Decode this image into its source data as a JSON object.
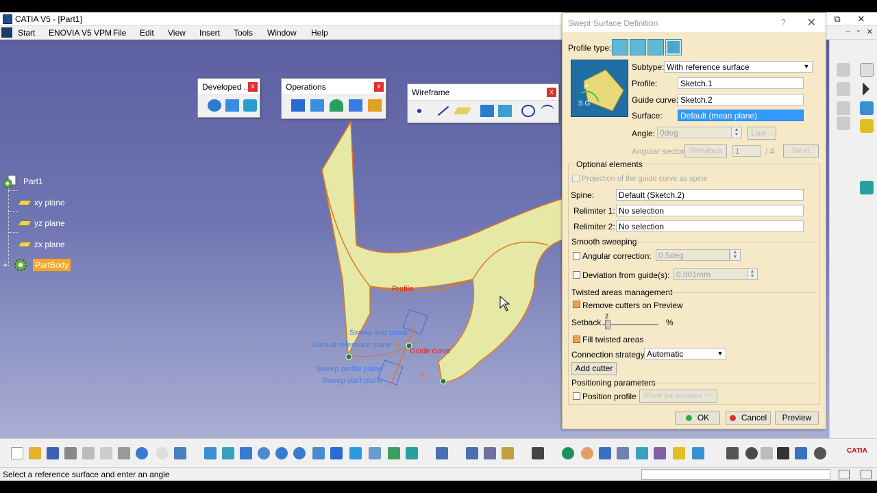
{
  "window": {
    "title": "CATIA V5 - [Part1]",
    "controls": [
      "⧉",
      "✕"
    ],
    "doc_controls": [
      "–",
      "▫",
      "✕"
    ]
  },
  "menu": {
    "items": [
      "Start",
      "ENOVIA V5 VPM",
      "File",
      "Edit",
      "View",
      "Insert",
      "Tools",
      "Window",
      "Help"
    ]
  },
  "tree": {
    "root": "Part1",
    "items": [
      "xy plane",
      "yz plane",
      "zx plane"
    ],
    "body": "PartBody"
  },
  "toolbars": {
    "developed": "Developed ...",
    "operations": "Operations",
    "wireframe": "Wireframe",
    "close": "x"
  },
  "viewport_labels": {
    "profile": "Profile",
    "sweep_end_plane": "Sweep end plane",
    "default_reference_plane": "Default reference plane",
    "guide_curve": "Guide curve",
    "sweep_profile_plane": "Sweep profile plane",
    "sweep_start_plane": "Sweep start plane",
    "h1": "H",
    "h2": "H"
  },
  "dialog": {
    "title": "Swept Surface Definition",
    "help": "?",
    "close": "✕",
    "profile_type_label": "Profile type:",
    "subtype_label": "Subtype:",
    "subtype_value": "With reference surface",
    "profile_label": "Profile:",
    "profile_value": "Sketch.1",
    "guide_label": "Guide curve:",
    "guide_value": "Sketch.2",
    "surface_label": "Surface:",
    "surface_value": "Default (mean plane)",
    "angle_label": "Angle:",
    "angle_value": "0deg",
    "law_button": "Law...",
    "angular_sector_label": "Angular sector:",
    "previous_button": "Previous",
    "sector_value": "1",
    "sector_total": "/ 4",
    "next_button": "Next",
    "optional_elements": "Optional elements",
    "projection_label": "Projection of the guide curve as spine",
    "spine_label": "Spine:",
    "spine_value": "Default (Sketch.2)",
    "relimiter1_label": "Relimiter 1:",
    "relimiter1_value": "No selection",
    "relimiter2_label": "Relimiter 2:",
    "relimiter2_value": "No selection",
    "smooth_sweeping": "Smooth sweeping",
    "angular_correction_label": "Angular correction:",
    "angular_correction_value": "0.5deg",
    "deviation_label": "Deviation from guide(s):",
    "deviation_value": "0.001mm",
    "twisted_areas": "Twisted areas management",
    "remove_cutters": "Remove cutters on Preview",
    "setback_label": "Setback",
    "setback_value": "2",
    "setback_unit": "%",
    "fill_twisted": "Fill twisted areas",
    "connection_label": "Connection strategy:",
    "connection_value": "Automatic",
    "add_cutter": "Add cutter",
    "positioning_parameters": "Positioning parameters",
    "position_profile": "Position profile",
    "show_parameters": "Show parameters >>",
    "ok": "OK",
    "cancel": "Cancel",
    "preview": "Preview"
  },
  "status": {
    "message": "Select a reference surface and enter an angle"
  },
  "colors": {
    "surface": "#e6e9a5",
    "edge": "#e07a1e",
    "viewport_top": "#5c5fa0",
    "viewport_bottom": "#a9aed3",
    "dialog_bg": "#f5e9c8",
    "selection": "#3399ff"
  }
}
